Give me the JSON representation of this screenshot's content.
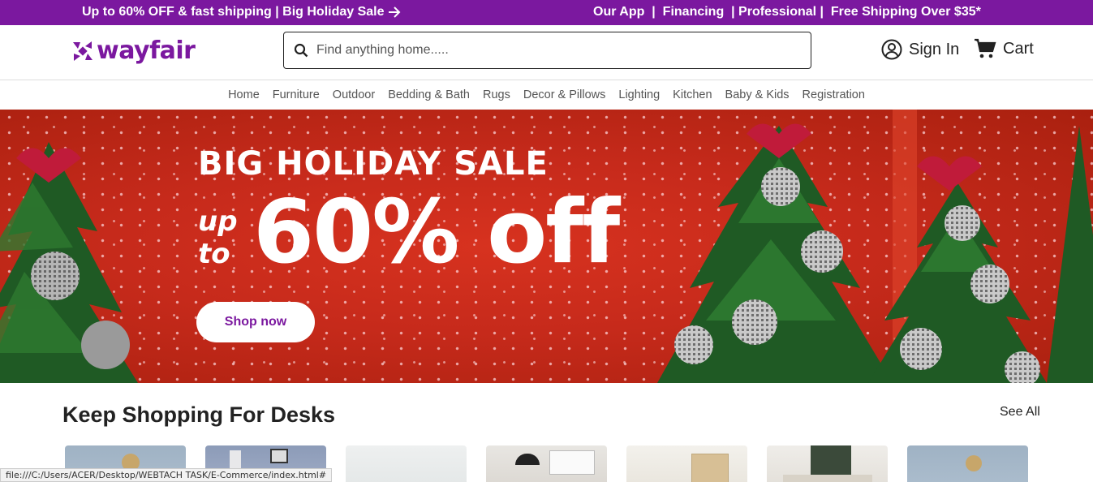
{
  "promo": {
    "left_text": "Up to 60% OFF & fast shipping | Big Holiday Sale",
    "right_links": [
      "Our App",
      "Financing",
      "Professional",
      "Free Shipping Over $35*"
    ]
  },
  "header": {
    "logo_text": "wayfair",
    "search_placeholder": "Find anything home.....",
    "signin_label": "Sign In",
    "cart_label": "Cart"
  },
  "nav": {
    "items": [
      "Home",
      "Furniture",
      "Outdoor",
      "Bedding & Bath",
      "Rugs",
      "Decor & Pillows",
      "Lighting",
      "Kitchen",
      "Baby & Kids",
      "Registration"
    ]
  },
  "hero": {
    "title": "BIG HOLIDAY SALE",
    "upto_line1": "up",
    "upto_line2": "to",
    "big": "60% off",
    "button": "Shop now"
  },
  "section": {
    "title": "Keep Shopping For Desks",
    "see_all": "See All"
  },
  "status_bar": {
    "url": "file:///C:/Users/ACER/Desktop/WEBTACH TASK/E-Commerce/index.html#"
  },
  "colors": {
    "brand_purple": "#7b189f",
    "hero_red": "#c62a1b"
  }
}
